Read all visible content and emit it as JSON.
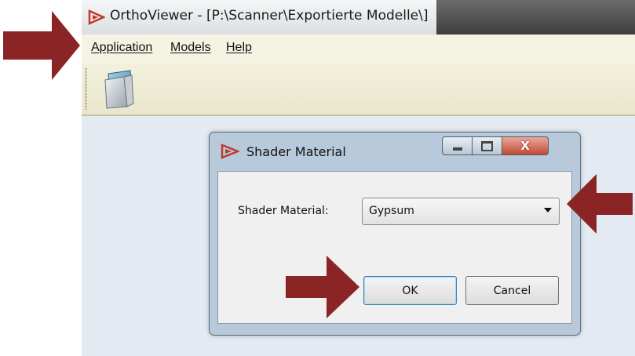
{
  "window": {
    "title": "OrthoViewer - [P:\\Scanner\\Exportierte Modelle\\]"
  },
  "menu": {
    "items": [
      {
        "label": "Application"
      },
      {
        "label": "Models"
      },
      {
        "label": "Help"
      }
    ]
  },
  "dialog": {
    "title": "Shader Material",
    "field_label": "Shader Material:",
    "selected_value": "Gypsum",
    "ok_label": "OK",
    "cancel_label": "Cancel",
    "close_glyph": "X"
  },
  "colors": {
    "arrow": "#8b2424",
    "logo": "#c0392b",
    "menubar": "#f5f3e1"
  },
  "icons": [
    "orthoviewer-logo-icon",
    "open-folder-icon",
    "minimize-icon",
    "maximize-icon",
    "close-icon",
    "dropdown-arrow-icon",
    "annotation-arrow-icon"
  ]
}
